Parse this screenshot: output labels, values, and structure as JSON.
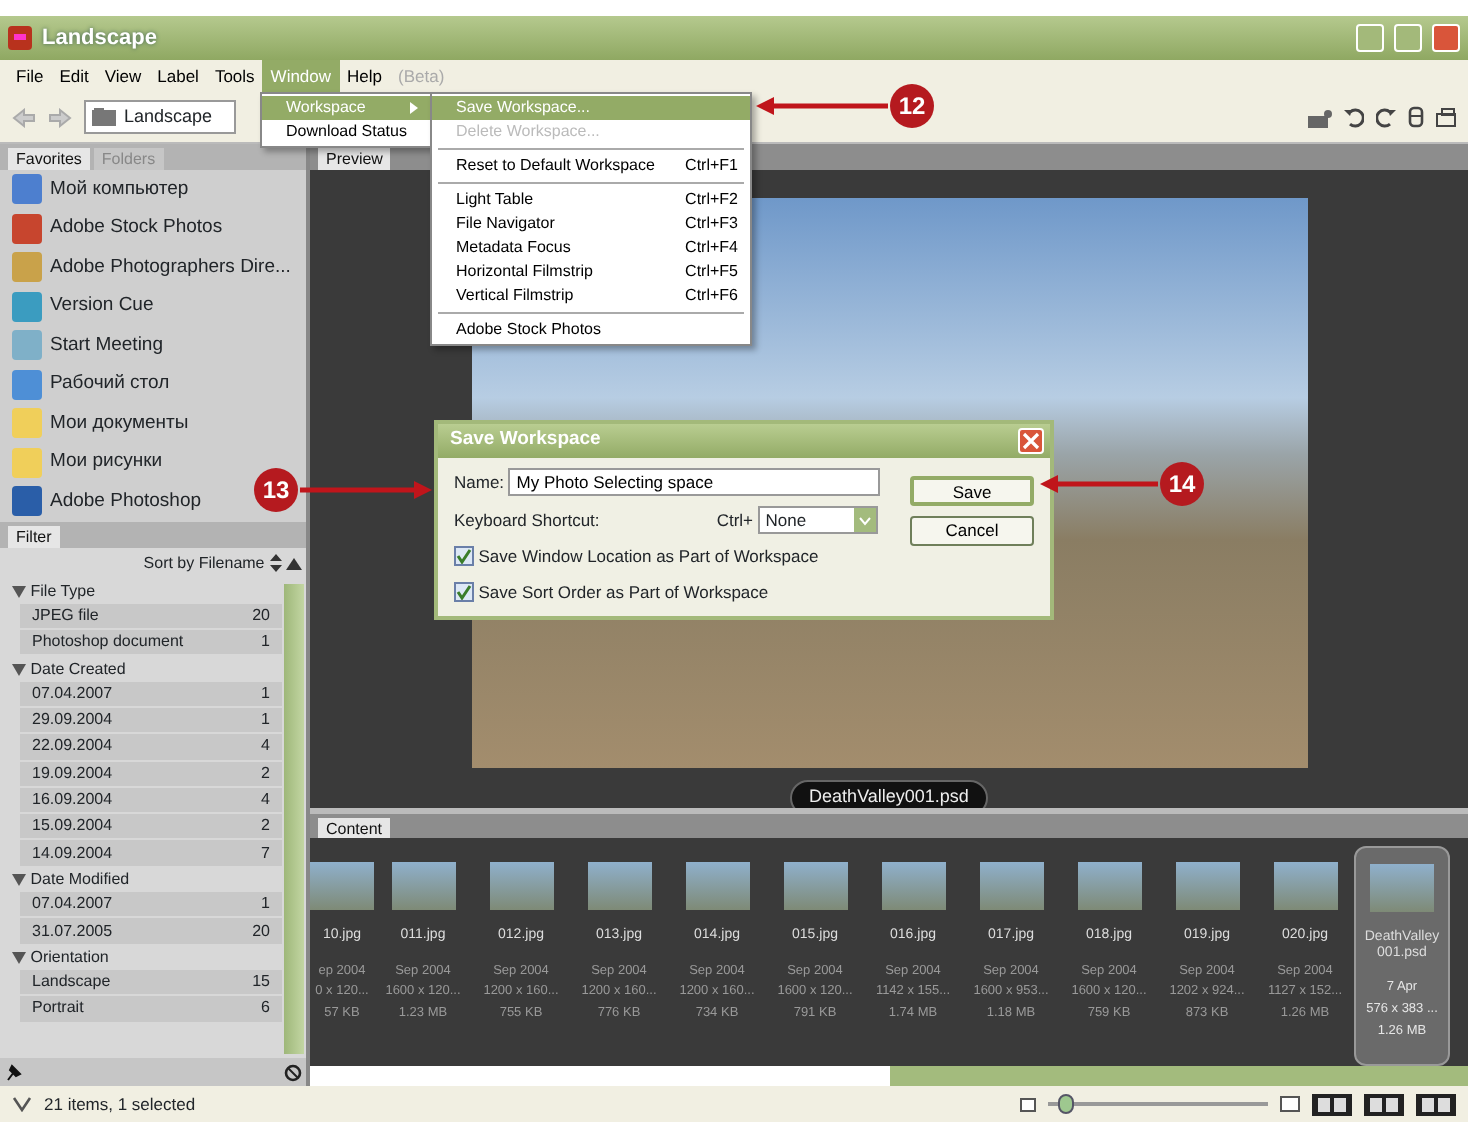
{
  "window": {
    "title": "Landscape"
  },
  "menu_bar": [
    {
      "label": "File",
      "selected": false,
      "disabled": false
    },
    {
      "label": "Edit",
      "selected": false,
      "disabled": false
    },
    {
      "label": "View",
      "selected": false,
      "disabled": false
    },
    {
      "label": "Label",
      "selected": false,
      "disabled": false
    },
    {
      "label": "Tools",
      "selected": false,
      "disabled": false
    },
    {
      "label": "Window",
      "selected": true,
      "disabled": false
    },
    {
      "label": "Help",
      "selected": false,
      "disabled": false
    },
    {
      "label": "(Beta)",
      "selected": false,
      "disabled": true
    }
  ],
  "window_menu": [
    {
      "label": "Workspace",
      "submenu": true,
      "selected": true
    },
    {
      "label": "Download Status",
      "submenu": false,
      "selected": false
    }
  ],
  "workspace_submenu": [
    {
      "kind": "item",
      "label": "Save Workspace...",
      "selected": true,
      "disabled": false
    },
    {
      "kind": "item",
      "label": "Delete Workspace...",
      "selected": false,
      "disabled": true
    },
    {
      "kind": "separator"
    },
    {
      "kind": "item",
      "label": "Reset to Default Workspace",
      "shortcut": "Ctrl+F1",
      "selected": false,
      "disabled": false
    },
    {
      "kind": "separator"
    },
    {
      "kind": "item",
      "label": "Light Table",
      "shortcut": "Ctrl+F2",
      "selected": false,
      "disabled": false
    },
    {
      "kind": "item",
      "label": "File Navigator",
      "shortcut": "Ctrl+F3",
      "selected": false,
      "disabled": false
    },
    {
      "kind": "item",
      "label": "Metadata Focus",
      "shortcut": "Ctrl+F4",
      "selected": false,
      "disabled": false
    },
    {
      "kind": "item",
      "label": "Horizontal Filmstrip",
      "shortcut": "Ctrl+F5",
      "selected": false,
      "disabled": false
    },
    {
      "kind": "item",
      "label": "Vertical Filmstrip",
      "shortcut": "Ctrl+F6",
      "selected": false,
      "disabled": false
    },
    {
      "kind": "separator"
    },
    {
      "kind": "item",
      "label": "Adobe Stock Photos",
      "selected": false,
      "disabled": false
    }
  ],
  "toolbar": {
    "path": "Landscape"
  },
  "favorites_tabs": [
    {
      "label": "Favorites",
      "selected": true
    },
    {
      "label": "Folders",
      "selected": false
    }
  ],
  "favorites": [
    {
      "label": "Мой компьютер",
      "kind": "computer"
    },
    {
      "label": "Adobe Stock Photos",
      "kind": "stock"
    },
    {
      "label": "Adobe Photographers Dire...",
      "kind": "photographer"
    },
    {
      "label": "Version Cue",
      "kind": "cue"
    },
    {
      "label": "Start Meeting",
      "kind": "meeting"
    },
    {
      "label": "Рабочий стол",
      "kind": "desktop"
    },
    {
      "label": "Мои документы",
      "kind": "folder"
    },
    {
      "label": "Мои рисунки",
      "kind": "folder"
    },
    {
      "label": "Adobe Photoshop",
      "kind": "photoshop"
    }
  ],
  "filter": {
    "tab": "Filter",
    "sort": "Sort by Filename",
    "groups": [
      {
        "label": "File Type",
        "expanded": true,
        "children": [
          {
            "label": "JPEG file",
            "count": "20"
          },
          {
            "label": "Photoshop document",
            "count": "1"
          }
        ]
      },
      {
        "label": "Date Created",
        "expanded": true,
        "children": [
          {
            "label": "07.04.2007",
            "count": "1"
          },
          {
            "label": "29.09.2004",
            "count": "1"
          },
          {
            "label": "22.09.2004",
            "count": "4"
          },
          {
            "label": "19.09.2004",
            "count": "2"
          },
          {
            "label": "16.09.2004",
            "count": "4"
          },
          {
            "label": "15.09.2004",
            "count": "2"
          },
          {
            "label": "14.09.2004",
            "count": "7"
          }
        ]
      },
      {
        "label": "Date Modified",
        "expanded": true,
        "children": [
          {
            "label": "07.04.2007",
            "count": "1"
          },
          {
            "label": "31.07.2005",
            "count": "20"
          }
        ]
      },
      {
        "label": "Orientation",
        "expanded": true,
        "children": [
          {
            "label": "Landscape",
            "count": "15"
          },
          {
            "label": "Portrait",
            "count": "6"
          }
        ]
      }
    ]
  },
  "preview": {
    "tab": "Preview",
    "caption": "DeathValley001.psd"
  },
  "content": {
    "tab": "Content",
    "items": [
      {
        "name": "10.jpg",
        "date": "ep 2004",
        "size": "0 x 120...",
        "file_size": "57 KB",
        "selected": false
      },
      {
        "name": "011.jpg",
        "date": "Sep 2004",
        "size": "1600 x 120...",
        "file_size": "1.23 MB",
        "selected": false
      },
      {
        "name": "012.jpg",
        "date": "Sep 2004",
        "size": "1200 x 160...",
        "file_size": "755 KB",
        "selected": false
      },
      {
        "name": "013.jpg",
        "date": "Sep 2004",
        "size": "1200 x 160...",
        "file_size": "776 KB",
        "selected": false
      },
      {
        "name": "014.jpg",
        "date": "Sep 2004",
        "size": "1200 x 160...",
        "file_size": "734 KB",
        "selected": false
      },
      {
        "name": "015.jpg",
        "date": "Sep 2004",
        "size": "1600 x 120...",
        "file_size": "791 KB",
        "selected": false
      },
      {
        "name": "016.jpg",
        "date": "Sep 2004",
        "size": "1142 x 155...",
        "file_size": "1.74 MB",
        "selected": false
      },
      {
        "name": "017.jpg",
        "date": "Sep 2004",
        "size": "1600 x 953...",
        "file_size": "1.18 MB",
        "selected": false
      },
      {
        "name": "018.jpg",
        "date": "Sep 2004",
        "size": "1600 x 120...",
        "file_size": "759 KB",
        "selected": false
      },
      {
        "name": "019.jpg",
        "date": "Sep 2004",
        "size": "1202 x 924...",
        "file_size": "873 KB",
        "selected": false
      },
      {
        "name": "020.jpg",
        "date": "Sep 2004",
        "size": "1127 x 152...",
        "file_size": "1.26 MB",
        "selected": false
      },
      {
        "name": "DeathValley 001.psd",
        "date": "7 Apr",
        "size": "576 x 383 ...",
        "file_size": "1.26 MB",
        "selected": true
      }
    ]
  },
  "dialog": {
    "title": "Save Workspace",
    "name_label": "Name:",
    "name_value": "My Photo Selecting space",
    "shortcut_label": "Keyboard Shortcut:",
    "shortcut_prefix": "Ctrl+",
    "shortcut_value": "None",
    "buttons": [
      {
        "label": "Save",
        "default": true
      },
      {
        "label": "Cancel",
        "default": false
      }
    ],
    "checkboxes": [
      {
        "label": "Save Window Location as Part of Workspace",
        "checked": true
      },
      {
        "label": "Save Sort Order as Part of Workspace",
        "checked": true
      }
    ]
  },
  "status_bar": {
    "text": "21 items, 1 selected",
    "zoom": {
      "level": 0.08
    }
  },
  "callouts": [
    {
      "label": "12"
    },
    {
      "label": "13"
    },
    {
      "label": "14"
    }
  ]
}
